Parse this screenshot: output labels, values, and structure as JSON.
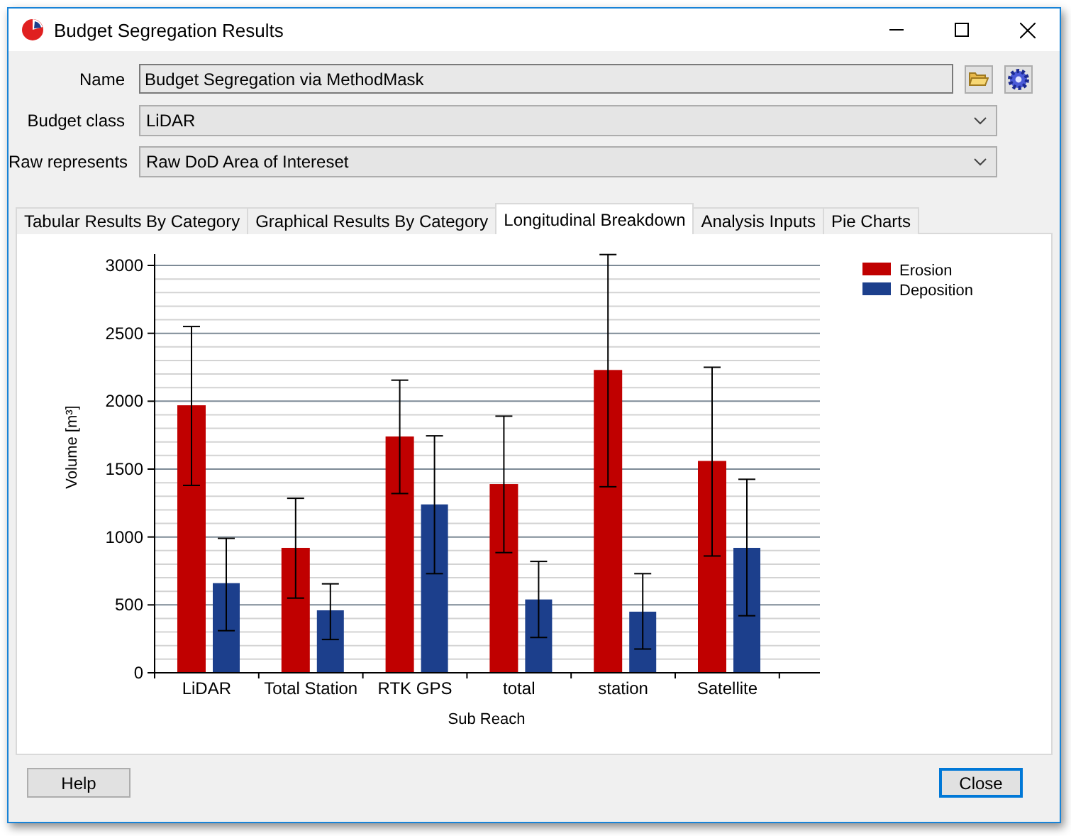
{
  "window": {
    "title": "Budget Segregation Results"
  },
  "fields": [
    {
      "kind": "text",
      "label": "Name",
      "value": "Budget Segregation via MethodMask"
    },
    {
      "kind": "combo",
      "label": "Budget class",
      "value": "LiDAR"
    },
    {
      "kind": "combo",
      "label": "Raw represents",
      "value": "Raw DoD Area of Intereset"
    }
  ],
  "tabs": [
    {
      "label": "Tabular Results By Category",
      "selected": false
    },
    {
      "label": "Graphical Results By Category",
      "selected": false
    },
    {
      "label": "Longitudinal Breakdown",
      "selected": true
    },
    {
      "label": "Analysis Inputs",
      "selected": false
    },
    {
      "label": "Pie Charts",
      "selected": false
    }
  ],
  "chart_data": {
    "type": "bar",
    "xlabel": "Sub Reach",
    "ylabel": "Volume [m³]",
    "categories": [
      "LiDAR",
      "Total Station",
      "RTK GPS",
      "total",
      "station",
      "Satellite"
    ],
    "ylim": [
      0,
      3000
    ],
    "grid": true,
    "legend": true,
    "yticks": [
      0,
      500,
      1000,
      1500,
      2000,
      2500,
      3000
    ],
    "series": [
      {
        "name": "Erosion",
        "color": "#c00000",
        "values": [
          1970,
          920,
          1740,
          1390,
          2230,
          1560
        ],
        "errors": [
          [
            1380,
            2550
          ],
          [
            550,
            1285
          ],
          [
            1320,
            2155
          ],
          [
            885,
            1890
          ],
          [
            1370,
            3080
          ],
          [
            860,
            2250
          ]
        ]
      },
      {
        "name": "Deposition",
        "color": "#1c3f8c",
        "values": [
          660,
          460,
          1240,
          540,
          450,
          920
        ],
        "errors": [
          [
            310,
            990
          ],
          [
            245,
            655
          ],
          [
            730,
            1745
          ],
          [
            260,
            820
          ],
          [
            175,
            730
          ],
          [
            420,
            1425
          ]
        ]
      }
    ]
  },
  "buttons": [
    {
      "label": "Help",
      "focused": false
    },
    {
      "label": "Close",
      "focused": true
    }
  ]
}
